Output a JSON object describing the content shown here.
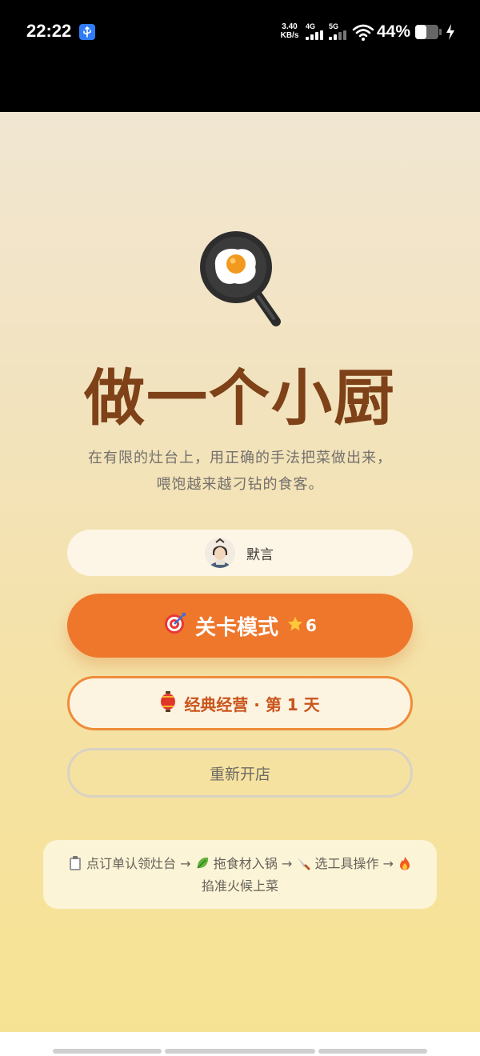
{
  "status_bar": {
    "time": "22:22",
    "net_speed_value": "3.40",
    "net_speed_unit": "KB/s",
    "sim1_label": "4G",
    "sim2_label": "5G",
    "battery": "44%",
    "icons": [
      "usb-debug-icon",
      "signal-icon",
      "wifi-icon",
      "battery-icon",
      "charging-icon"
    ]
  },
  "home": {
    "logo_icon": "frying-pan-egg-icon",
    "title": "做一个小厨",
    "subtitle_line1": "在有限的灶台上，用正确的手法把菜做出来，",
    "subtitle_line2": "喂饱越来越刁钻的食客。",
    "user": {
      "name": "默言",
      "avatar_icon": "avatar"
    },
    "level_button": {
      "icon": "target-icon",
      "label": "关卡模式",
      "star_icon": "star-icon",
      "stars": "6"
    },
    "classic_button": {
      "icon": "lantern-icon",
      "label": "经典经营 · 第 1 天"
    },
    "reopen_button": {
      "label": "重新开店"
    },
    "tips": {
      "step1": "点订单认领灶台",
      "step2": "拖食材入锅",
      "step3": "选工具操作",
      "step4": "掐准火候上菜",
      "arrow": "→",
      "icons": [
        "clipboard-icon",
        "leafy-green-icon",
        "knife-icon",
        "fire-icon"
      ]
    }
  },
  "colors": {
    "accent": "#ee772c",
    "title": "#7e4118",
    "classic_text": "#c9541c",
    "status_bar": "#000000"
  }
}
